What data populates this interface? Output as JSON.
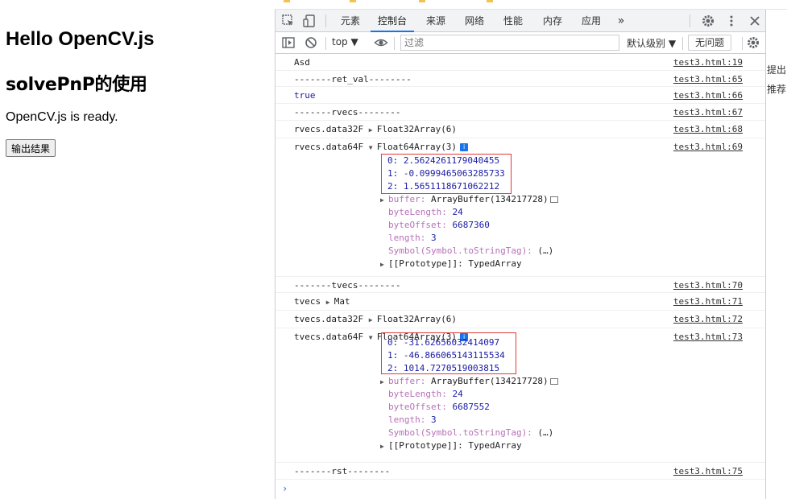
{
  "page": {
    "title": "Hello OpenCV.js",
    "subtitle": "solvePnP的使用",
    "status": "OpenCV.js is ready.",
    "button_label": "输出结果"
  },
  "devtools": {
    "tabs": [
      "元素",
      "控制台",
      "来源",
      "网络",
      "性能",
      "内存",
      "应用"
    ],
    "active_tab": "控制台",
    "more_tabs": "»",
    "context": "top ▼",
    "filter_placeholder": "过滤",
    "levels": "默认级别 ▼",
    "issues": "无问题",
    "icons": [
      "inspect-icon",
      "device-icon",
      "gear-icon",
      "kebab-icon",
      "close-icon",
      "sidebar-icon",
      "clear-icon",
      "eye-icon"
    ]
  },
  "console": {
    "lines": [
      {
        "text": "Asd",
        "src": "test3.html:19"
      },
      {
        "text": "-------ret_val--------",
        "src": "test3.html:65"
      },
      {
        "text": "true",
        "src": "test3.html:66"
      },
      {
        "text": "-------rvecs--------",
        "src": "test3.html:67"
      },
      {
        "label": "rvecs.data32F",
        "value": "Float32Array(6)",
        "src": "test3.html:68"
      },
      {
        "label": "rvecs.data64F",
        "value": "Float64Array(3)",
        "src": "test3.html:69"
      },
      {
        "text": "-------tvecs--------",
        "src": "test3.html:70"
      },
      {
        "label": "tvecs",
        "value": "Mat",
        "src": "test3.html:71"
      },
      {
        "label": "tvecs.data32F",
        "value": "Float32Array(6)",
        "src": "test3.html:72"
      },
      {
        "label": "tvecs.data64F",
        "value": "Float64Array(3)",
        "src": "test3.html:73"
      },
      {
        "text": "-------rst--------",
        "src": "test3.html:75"
      }
    ],
    "rvecs_entries": [
      "0: 2.5624261179040455",
      "1: -0.0999465063285733",
      "2: 1.5651118671062212"
    ],
    "tvecs_entries": [
      "0: -31.62656032414097",
      "1: -46.866065143115534",
      "2: 1014.7270519003815"
    ],
    "buffer_key": "buffer:",
    "buffer_val": "ArrayBuffer(134217728)",
    "bytelength_key": "byteLength:",
    "bytelength_val": "24",
    "byteoffset_key": "byteOffset:",
    "r_byteoffset_val": "6687360",
    "t_byteoffset_val": "6687552",
    "length_key": "length:",
    "length_val": "3",
    "symbol_key": "Symbol(Symbol.toStringTag):",
    "symbol_val": "(…)",
    "proto": "[[Prototype]]: TypedArray",
    "prompt": "›"
  },
  "right_strip": [
    "提出",
    "推荐"
  ],
  "colors": {
    "accent": "#1a73e8",
    "highlight_box": "#e03a3a",
    "number": "#1a1aa6",
    "property_key": "#881391"
  }
}
